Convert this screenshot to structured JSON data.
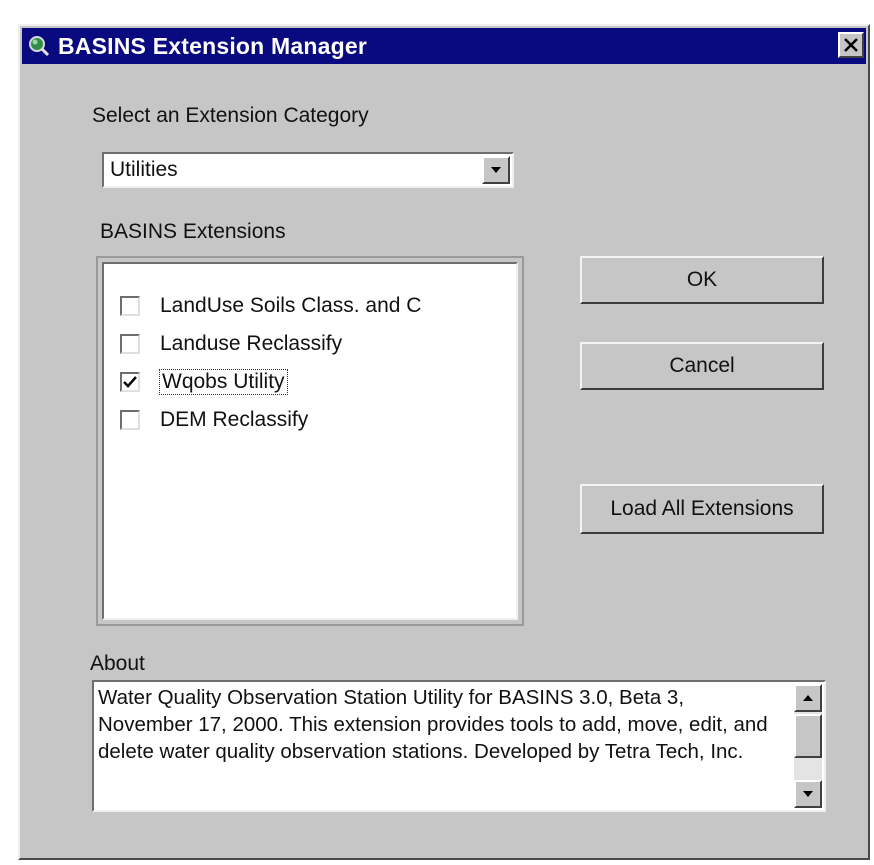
{
  "window": {
    "title": "BASINS Extension Manager",
    "close_icon": "close-x-icon",
    "app_icon": "magnifier-globe-icon"
  },
  "category": {
    "label": "Select an Extension Category",
    "selected": "Utilities",
    "dropdown_icon": "chevron-down-icon"
  },
  "extensions": {
    "label": "BASINS Extensions",
    "items": [
      {
        "label": "LandUse  Soils Class. and C",
        "checked": false
      },
      {
        "label": "Landuse Reclassify",
        "checked": false
      },
      {
        "label": "Wqobs Utility",
        "checked": true
      },
      {
        "label": "DEM Reclassify",
        "checked": false
      }
    ]
  },
  "buttons": {
    "ok": "OK",
    "cancel": "Cancel",
    "load_all": "Load All Extensions"
  },
  "about": {
    "label": "About",
    "text": "Water Quality Observation Station Utility for BASINS 3.0, Beta 3, November 17, 2000.  This extension provides tools to add, move, edit, and delete water quality observation stations.  Developed by Tetra Tech, Inc."
  }
}
